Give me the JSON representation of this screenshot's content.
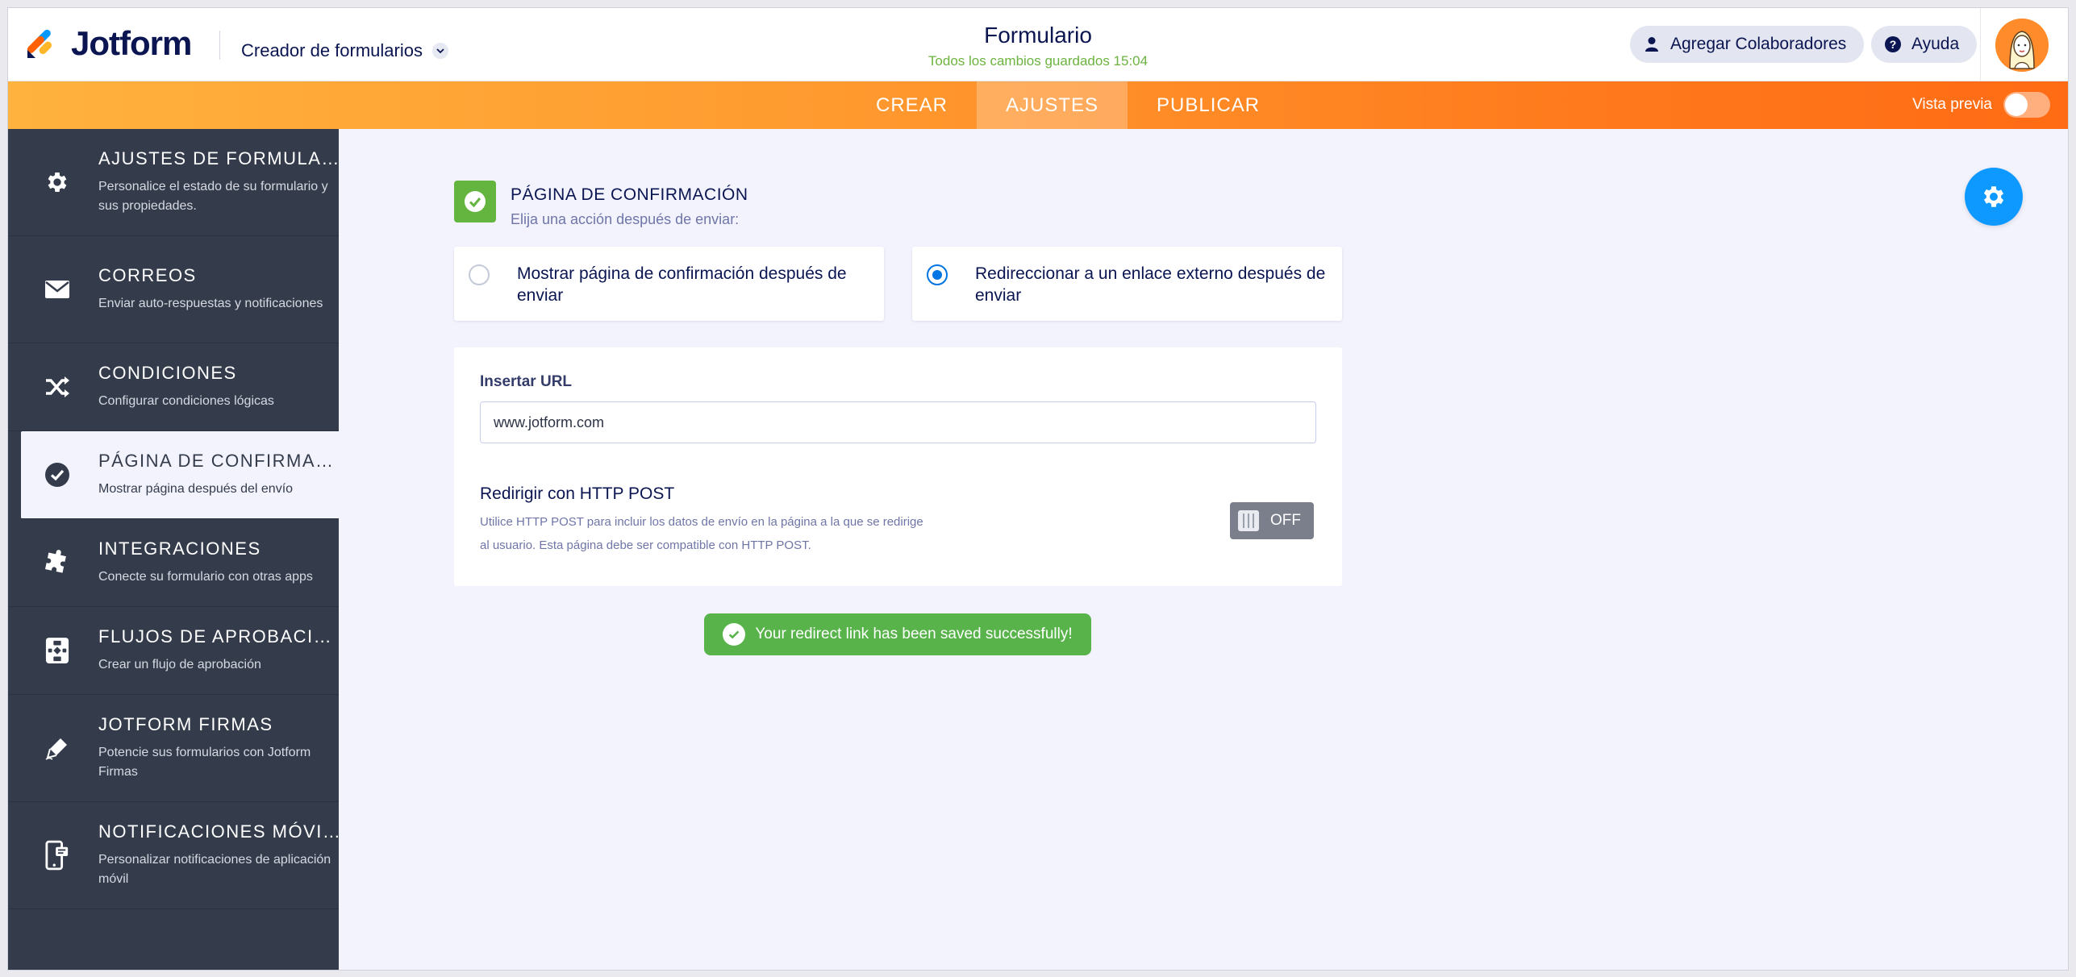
{
  "header": {
    "brand": "Jotform",
    "builder_menu": "Creador de formularios",
    "form_title": "Formulario",
    "save_status": "Todos los cambios guardados 15:04",
    "collaborators_button": "Agregar Colaboradores",
    "help_button": "Ayuda"
  },
  "nav": {
    "tabs": [
      "CREAR",
      "AJUSTES",
      "PUBLICAR"
    ],
    "active_tab": "AJUSTES",
    "preview_label": "Vista previa",
    "preview_enabled": false
  },
  "sidebar": {
    "items": [
      {
        "title": "AJUSTES DE FORMULARIO",
        "desc": "Personalice el estado de su formulario y sus propiedades.",
        "icon": "gear-icon"
      },
      {
        "title": "CORREOS",
        "desc": "Enviar auto-respuestas y notificaciones",
        "icon": "envelope-icon"
      },
      {
        "title": "CONDICIONES",
        "desc": "Configurar condiciones lógicas",
        "icon": "shuffle-icon"
      },
      {
        "title": "PÁGINA DE CONFIRMACI...",
        "desc": "Mostrar página después del envío",
        "icon": "check-circle-icon",
        "active": true
      },
      {
        "title": "INTEGRACIONES",
        "desc": "Conecte su formulario con otras apps",
        "icon": "puzzle-icon"
      },
      {
        "title": "FLUJOS DE APROBACIÓN",
        "desc": "Crear un flujo de aprobación",
        "icon": "flow-icon"
      },
      {
        "title": "JOTFORM FIRMAS",
        "desc": "Potencie sus formularios con Jotform Firmas",
        "icon": "pen-icon"
      },
      {
        "title": "NOTIFICACIONES MÓVIL...",
        "desc": "Personalizar notificaciones de aplicación móvil",
        "icon": "mobile-icon"
      }
    ]
  },
  "main": {
    "section_title": "PÁGINA DE CONFIRMACIÓN",
    "section_subtitle": "Elija una acción después de enviar:",
    "options": [
      {
        "label": "Mostrar página de confirmación después de enviar",
        "selected": false
      },
      {
        "label": "Redireccionar a un enlace externo después de enviar",
        "selected": true
      }
    ],
    "url_label": "Insertar URL",
    "url_value": "www.jotform.com",
    "post_title": "Redirigir con HTTP POST",
    "post_desc": "Utilice HTTP POST para incluir los datos de envío en la página a la que se redirige al usuario. Esta página debe ser compatible con HTTP POST.",
    "post_toggle": "OFF",
    "toast": "Your redirect link has been saved successfully!"
  },
  "colors": {
    "accent_orange": "#ff7b1d",
    "sidebar_bg": "#343c4c",
    "success_green": "#58b44a",
    "primary_blue": "#0d99ff"
  }
}
